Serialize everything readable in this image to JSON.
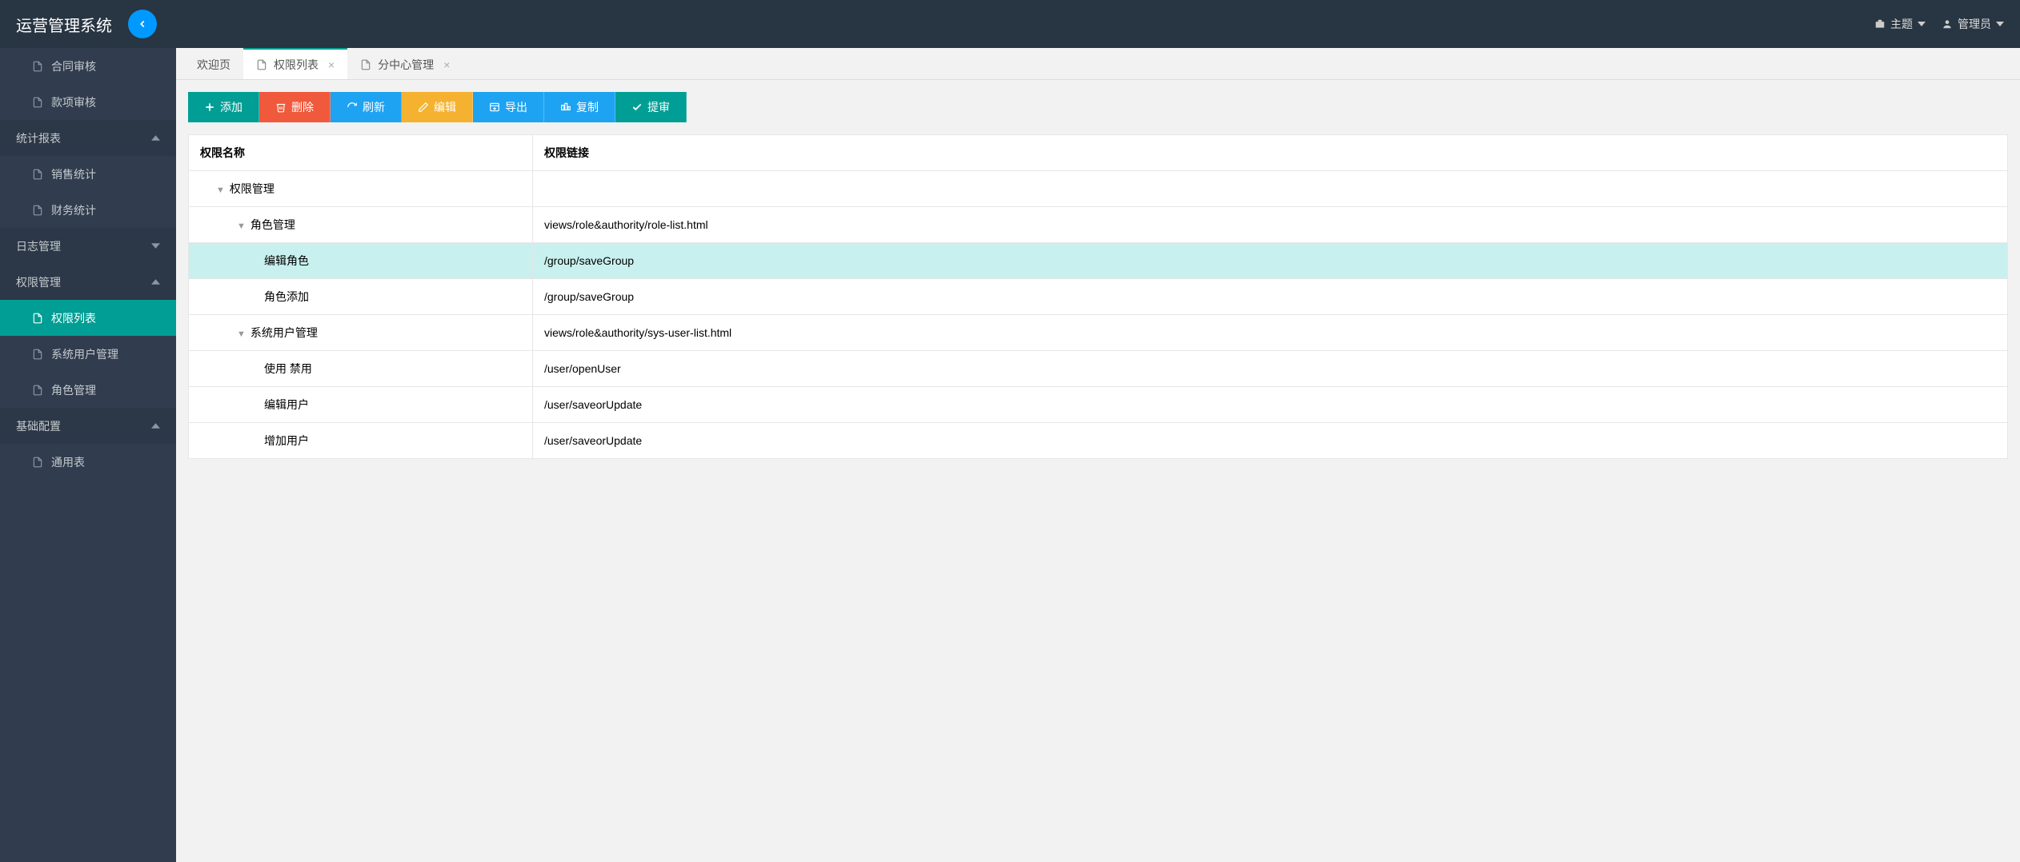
{
  "header": {
    "title": "运营管理系统",
    "theme_label": "主题",
    "user_label": "管理员"
  },
  "sidebar": {
    "items": [
      {
        "type": "item",
        "label": "合同审核"
      },
      {
        "type": "item",
        "label": "款项审核"
      },
      {
        "type": "group",
        "label": "统计报表",
        "expanded": true
      },
      {
        "type": "item",
        "label": "销售统计"
      },
      {
        "type": "item",
        "label": "财务统计"
      },
      {
        "type": "group",
        "label": "日志管理",
        "expanded": false
      },
      {
        "type": "group",
        "label": "权限管理",
        "expanded": true
      },
      {
        "type": "item",
        "label": "权限列表",
        "active": true
      },
      {
        "type": "item",
        "label": "系统用户管理"
      },
      {
        "type": "item",
        "label": "角色管理"
      },
      {
        "type": "group",
        "label": "基础配置",
        "expanded": true
      },
      {
        "type": "item",
        "label": "通用表"
      }
    ]
  },
  "tabs": [
    {
      "label": "欢迎页",
      "closable": false,
      "active": false
    },
    {
      "label": "权限列表",
      "closable": true,
      "active": true
    },
    {
      "label": "分中心管理",
      "closable": true,
      "active": false
    }
  ],
  "toolbar": {
    "add": "添加",
    "delete": "删除",
    "refresh": "刷新",
    "edit": "编辑",
    "export": "导出",
    "copy": "复制",
    "submit": "提审"
  },
  "table": {
    "columns": {
      "name": "权限名称",
      "link": "权限链接"
    },
    "rows": [
      {
        "name": "权限管理",
        "link": "",
        "level": 0,
        "toggle": true
      },
      {
        "name": "角色管理",
        "link": "views/role&authority/role-list.html",
        "level": 1,
        "toggle": true
      },
      {
        "name": "编辑角色",
        "link": "/group/saveGroup",
        "level": 2,
        "highlight": true
      },
      {
        "name": "角色添加",
        "link": "/group/saveGroup",
        "level": 2
      },
      {
        "name": "系统用户管理",
        "link": "views/role&authority/sys-user-list.html",
        "level": 1,
        "toggle": true
      },
      {
        "name": "使用 禁用",
        "link": "/user/openUser",
        "level": 2
      },
      {
        "name": "编辑用户",
        "link": "/user/saveorUpdate",
        "level": 2
      },
      {
        "name": "增加用户",
        "link": "/user/saveorUpdate",
        "level": 2
      }
    ]
  }
}
